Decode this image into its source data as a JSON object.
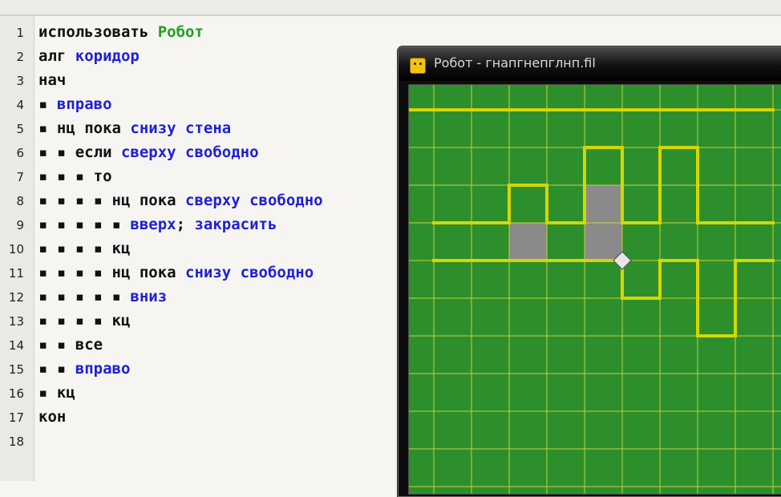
{
  "editor": {
    "line_numbers": [
      "1",
      "2",
      "3",
      "4",
      "5",
      "6",
      "7",
      "8",
      "9",
      "10",
      "11",
      "12",
      "13",
      "14",
      "15",
      "16",
      "17",
      "18"
    ],
    "lines": [
      [
        {
          "t": "использовать ",
          "c": "kw"
        },
        {
          "t": "Робот",
          "c": "green"
        }
      ],
      [
        {
          "t": "алг ",
          "c": "kw"
        },
        {
          "t": "коридор",
          "c": "blue"
        }
      ],
      [
        {
          "t": "нач",
          "c": "kw"
        }
      ],
      [
        {
          "t": "▪ ",
          "c": "dot"
        },
        {
          "t": "вправо",
          "c": "blue"
        }
      ],
      [
        {
          "t": "▪ ",
          "c": "dot"
        },
        {
          "t": "нц пока ",
          "c": "kw"
        },
        {
          "t": "снизу стена",
          "c": "blue"
        }
      ],
      [
        {
          "t": "▪ ▪ ",
          "c": "dot"
        },
        {
          "t": "если ",
          "c": "kw"
        },
        {
          "t": "сверху свободно",
          "c": "blue"
        }
      ],
      [
        {
          "t": "▪ ▪ ▪ ",
          "c": "dot"
        },
        {
          "t": "то",
          "c": "kw"
        }
      ],
      [
        {
          "t": "▪ ▪ ▪ ▪ ",
          "c": "dot"
        },
        {
          "t": "нц пока ",
          "c": "kw"
        },
        {
          "t": "сверху свободно",
          "c": "blue"
        }
      ],
      [
        {
          "t": "▪ ▪ ▪ ▪ ▪ ",
          "c": "dot"
        },
        {
          "t": "вверх",
          "c": "blue"
        },
        {
          "t": "; ",
          "c": "kw"
        },
        {
          "t": "закрасить",
          "c": "blue"
        }
      ],
      [
        {
          "t": "▪ ▪ ▪ ▪ ",
          "c": "dot"
        },
        {
          "t": "кц",
          "c": "kw"
        }
      ],
      [
        {
          "t": "▪ ▪ ▪ ▪ ",
          "c": "dot"
        },
        {
          "t": "нц пока ",
          "c": "kw"
        },
        {
          "t": "снизу свободно",
          "c": "blue"
        }
      ],
      [
        {
          "t": "▪ ▪ ▪ ▪ ▪ ",
          "c": "dot"
        },
        {
          "t": "вниз",
          "c": "blue"
        }
      ],
      [
        {
          "t": "▪ ▪ ▪ ▪ ",
          "c": "dot"
        },
        {
          "t": "кц",
          "c": "kw"
        }
      ],
      [
        {
          "t": "▪ ▪ ",
          "c": "dot"
        },
        {
          "t": "все",
          "c": "kw"
        }
      ],
      [
        {
          "t": "▪ ▪ ",
          "c": "dot"
        },
        {
          "t": "вправо",
          "c": "blue"
        }
      ],
      [
        {
          "t": "▪ ",
          "c": "dot"
        },
        {
          "t": "кц",
          "c": "kw"
        }
      ],
      [
        {
          "t": "кон",
          "c": "kw"
        }
      ],
      []
    ]
  },
  "robot_window": {
    "title": "Робот - гнапгнепглнп.fil",
    "icon": "robot-face-icon"
  },
  "field": {
    "cols": 10,
    "rows": 11,
    "painted_cells": [
      [
        3,
        4
      ],
      [
        5,
        3
      ],
      [
        5,
        4
      ]
    ],
    "robot_cell": [
      6,
      5
    ],
    "walls": [
      {
        "type": "h",
        "row": 1,
        "from": 0,
        "to": 10
      },
      {
        "type": "v",
        "col": 0,
        "from": 1,
        "to": 11
      },
      {
        "type": "h",
        "row": 4,
        "from": 1,
        "to": 3
      },
      {
        "type": "v",
        "col": 3,
        "from": 3,
        "to": 4
      },
      {
        "type": "h",
        "row": 3,
        "from": 3,
        "to": 4
      },
      {
        "type": "v",
        "col": 4,
        "from": 3,
        "to": 4
      },
      {
        "type": "h",
        "row": 4,
        "from": 4,
        "to": 5
      },
      {
        "type": "v",
        "col": 5,
        "from": 2,
        "to": 4
      },
      {
        "type": "h",
        "row": 2,
        "from": 5,
        "to": 6
      },
      {
        "type": "v",
        "col": 6,
        "from": 2,
        "to": 4
      },
      {
        "type": "h",
        "row": 4,
        "from": 6,
        "to": 7
      },
      {
        "type": "v",
        "col": 7,
        "from": 2,
        "to": 4
      },
      {
        "type": "h",
        "row": 2,
        "from": 7,
        "to": 8
      },
      {
        "type": "v",
        "col": 8,
        "from": 2,
        "to": 4
      },
      {
        "type": "h",
        "row": 4,
        "from": 8,
        "to": 10
      },
      {
        "type": "h",
        "row": 5,
        "from": 1,
        "to": 6
      },
      {
        "type": "v",
        "col": 6,
        "from": 5,
        "to": 6
      },
      {
        "type": "h",
        "row": 6,
        "from": 6,
        "to": 7
      },
      {
        "type": "v",
        "col": 7,
        "from": 5,
        "to": 6
      },
      {
        "type": "h",
        "row": 5,
        "from": 7,
        "to": 8
      },
      {
        "type": "v",
        "col": 8,
        "from": 5,
        "to": 7
      },
      {
        "type": "h",
        "row": 7,
        "from": 8,
        "to": 9
      },
      {
        "type": "v",
        "col": 9,
        "from": 5,
        "to": 7
      },
      {
        "type": "h",
        "row": 5,
        "from": 9,
        "to": 10
      }
    ],
    "colors": {
      "background": "#2c8f2c",
      "grid": "#c8d23a",
      "wall": "#d6d600",
      "painted": "#8a8a8a",
      "robot": "#e6e6e6"
    }
  }
}
